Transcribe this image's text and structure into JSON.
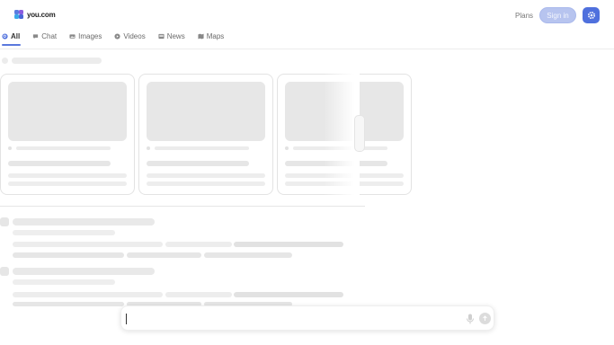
{
  "brand": {
    "name": "you.com",
    "logo_colors": [
      "#5a7be0",
      "#8a5ce0",
      "#3aa8e8",
      "#4a66d8"
    ]
  },
  "header": {
    "plans_label": "Plans",
    "signin_label": "Sign in",
    "settings_icon": "gear-icon",
    "accent_color": "#4f70dd"
  },
  "tabs": [
    {
      "label": "All",
      "icon": "search-circle-icon",
      "active": true
    },
    {
      "label": "Chat",
      "icon": "chat-bubble-icon",
      "active": false
    },
    {
      "label": "Images",
      "icon": "image-icon",
      "active": false
    },
    {
      "label": "Videos",
      "icon": "play-icon",
      "active": false
    },
    {
      "label": "News",
      "icon": "newspaper-icon",
      "active": false
    },
    {
      "label": "Maps",
      "icon": "map-icon",
      "active": false
    }
  ],
  "search": {
    "value": "",
    "placeholder": "",
    "mic_icon": "microphone-icon",
    "send_icon": "send-icon"
  },
  "state": "loading"
}
